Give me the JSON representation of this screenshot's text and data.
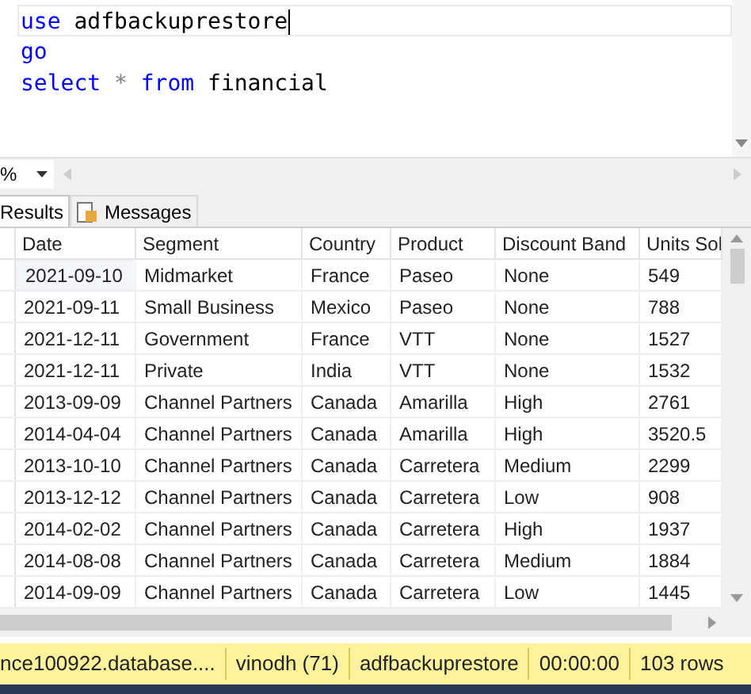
{
  "editor": {
    "lines": [
      {
        "current": true,
        "tokens": [
          {
            "kind": "keyword",
            "text": "use"
          },
          {
            "kind": "text",
            "text": " adfbackuprestore"
          }
        ]
      },
      {
        "current": false,
        "tokens": [
          {
            "kind": "keyword",
            "text": "go"
          }
        ]
      },
      {
        "current": false,
        "tokens": [
          {
            "kind": "keyword",
            "text": "select"
          },
          {
            "kind": "operator",
            "text": " * "
          },
          {
            "kind": "keyword",
            "text": "from"
          },
          {
            "kind": "text",
            "text": " financial"
          }
        ]
      }
    ]
  },
  "zoom": {
    "value": "%"
  },
  "tabs": [
    {
      "label": "Results",
      "selected": true
    },
    {
      "label": "Messages",
      "selected": false
    }
  ],
  "table": {
    "columns": [
      "Date",
      "Segment",
      "Country",
      "Product",
      "Discount Band",
      "Units Sol"
    ],
    "rows": [
      {
        "focused": true,
        "cells": [
          "2021-09-10",
          "Midmarket",
          "France",
          "Paseo",
          "None",
          "549"
        ]
      },
      {
        "focused": false,
        "cells": [
          "2021-09-11",
          "Small Business",
          "Mexico",
          "Paseo",
          "None",
          "788"
        ]
      },
      {
        "focused": false,
        "cells": [
          "2021-12-11",
          "Government",
          "France",
          "VTT",
          "None",
          "1527"
        ]
      },
      {
        "focused": false,
        "cells": [
          "2021-12-11",
          "Private",
          "India",
          "VTT",
          "None",
          "1532"
        ]
      },
      {
        "focused": false,
        "cells": [
          "2013-09-09",
          "Channel Partners",
          "Canada",
          "Amarilla",
          "High",
          "2761"
        ]
      },
      {
        "focused": false,
        "cells": [
          "2014-04-04",
          "Channel Partners",
          "Canada",
          "Amarilla",
          "High",
          "3520.5"
        ]
      },
      {
        "focused": false,
        "cells": [
          "2013-10-10",
          "Channel Partners",
          "Canada",
          "Carretera",
          "Medium",
          "2299"
        ]
      },
      {
        "focused": false,
        "cells": [
          "2013-12-12",
          "Channel Partners",
          "Canada",
          "Carretera",
          "Low",
          "908"
        ]
      },
      {
        "focused": false,
        "cells": [
          "2014-02-02",
          "Channel Partners",
          "Canada",
          "Carretera",
          "High",
          "1937"
        ]
      },
      {
        "focused": false,
        "cells": [
          "2014-08-08",
          "Channel Partners",
          "Canada",
          "Carretera",
          "Medium",
          "1884"
        ]
      },
      {
        "focused": false,
        "cells": [
          "2014-09-09",
          "Channel Partners",
          "Canada",
          "Carretera",
          "Low",
          "1445"
        ]
      }
    ]
  },
  "status_bar": [
    "nce100922.database....",
    "vinodh (71)",
    "adfbackuprestore",
    "00:00:00",
    "103 rows"
  ]
}
